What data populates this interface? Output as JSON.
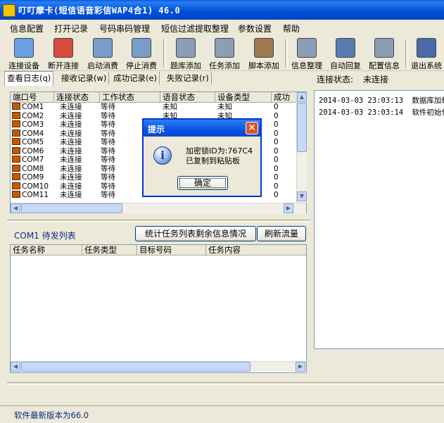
{
  "window": {
    "title": "叮叮摩卡(短信语音彩信WAP4合1) 46.0"
  },
  "menu": [
    "信息配置",
    "打开记录",
    "号码串码管理",
    "短信过滤提取整理",
    "参数设置",
    "帮助"
  ],
  "toolbar": [
    {
      "label": "连接设备",
      "icon": "connect-device-icon",
      "color": "#6aa0e0"
    },
    {
      "label": "断开连接",
      "icon": "disconnect-icon",
      "color": "#d84a3a"
    },
    {
      "label": "启动消费",
      "icon": "start-consume-icon",
      "color": "#7a9cc8"
    },
    {
      "label": "停止消费",
      "icon": "stop-consume-icon",
      "color": "#7a9cc8"
    },
    {
      "label": "题库添加",
      "icon": "question-bank-add-icon",
      "color": "#8a9fb5"
    },
    {
      "label": "任务添加",
      "icon": "task-add-icon",
      "color": "#8a9fb5"
    },
    {
      "label": "脚本添加",
      "icon": "script-add-icon",
      "color": "#a07850"
    },
    {
      "label": "信息整理",
      "icon": "info-organize-icon",
      "color": "#8a9fb5"
    },
    {
      "label": "自动回复",
      "icon": "auto-reply-icon",
      "color": "#5a7ab0"
    },
    {
      "label": "配置信息",
      "icon": "config-info-icon",
      "color": "#8a9fb5"
    },
    {
      "label": "退出系统",
      "icon": "exit-system-icon",
      "color": "#4a6aa8"
    }
  ],
  "tabs": [
    "查看日志(q)",
    "接收记录(w)",
    "成功记录(e)",
    "失败记录(r)"
  ],
  "port_table": {
    "columns": [
      "端口号",
      "连接状态",
      "工作状态",
      "语音状态",
      "设备类型",
      "成功"
    ],
    "rows": [
      [
        "COM1",
        "未连接",
        "等待",
        "未知",
        "未知",
        "0"
      ],
      [
        "COM2",
        "未连接",
        "等待",
        "未知",
        "未知",
        "0"
      ],
      [
        "COM3",
        "未连接",
        "等待",
        "",
        "",
        "0"
      ],
      [
        "COM4",
        "未连接",
        "等待",
        "",
        "",
        "0"
      ],
      [
        "COM5",
        "未连接",
        "等待",
        "",
        "",
        "0"
      ],
      [
        "COM6",
        "未连接",
        "等待",
        "",
        "",
        "0"
      ],
      [
        "COM7",
        "未连接",
        "等待",
        "",
        "",
        "0"
      ],
      [
        "COM8",
        "未连接",
        "等待",
        "",
        "",
        "0"
      ],
      [
        "COM9",
        "未连接",
        "等待",
        "",
        "",
        "0"
      ],
      [
        "COM10",
        "未连接",
        "等待",
        "",
        "",
        "0"
      ],
      [
        "COM11",
        "未连接",
        "等待",
        "",
        "",
        "0"
      ]
    ]
  },
  "connection": {
    "label": "连接状态:",
    "value": "未连接"
  },
  "log": [
    {
      "time": "2014-03-03 23:03:13",
      "text": "数据库加载"
    },
    {
      "time": "2014-03-03 23:03:14",
      "text": "软件初始化"
    }
  ],
  "pending": {
    "title": "COM1 待发列表",
    "stats_button": "统计任务列表剩余信息情况",
    "refresh_button": "刷新流量",
    "columns": [
      "任务名称",
      "任务类型",
      "目标号码",
      "任务内容"
    ]
  },
  "dialog": {
    "title": "提示",
    "line1": "加密锁ID为:767C4",
    "line2": "已复制到粘贴板",
    "ok": "确定"
  },
  "status": {
    "version_text": "软件最新版本为66.0"
  }
}
